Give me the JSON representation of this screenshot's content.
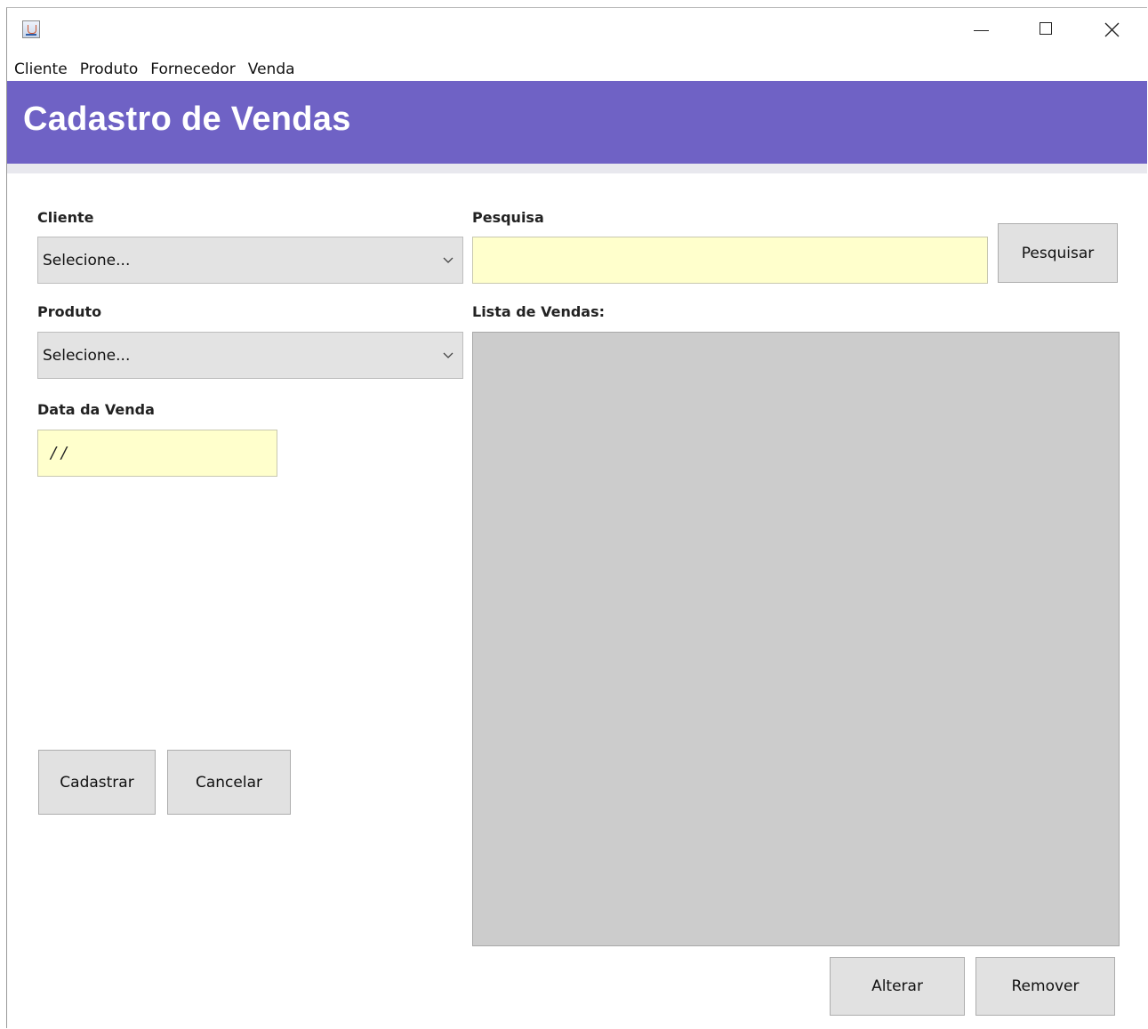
{
  "menu": {
    "items": [
      "Cliente",
      "Produto",
      "Fornecedor",
      "Venda"
    ]
  },
  "header": {
    "title": "Cadastro de Vendas",
    "background_color": "#6f62c5"
  },
  "form": {
    "cliente_label": "Cliente",
    "cliente_value": "Selecione...",
    "produto_label": "Produto",
    "produto_value": "Selecione...",
    "data_label": "Data da Venda",
    "data_value": "/ /",
    "cadastrar_label": "Cadastrar",
    "cancelar_label": "Cancelar"
  },
  "search": {
    "label": "Pesquisa",
    "value": "",
    "button_label": "Pesquisar"
  },
  "list": {
    "label": "Lista de Vendas:",
    "alterar_label": "Alterar",
    "remover_label": "Remover"
  },
  "icons": {
    "app": "java-app-icon",
    "minimize": "minimize-icon",
    "maximize": "maximize-icon",
    "close": "close-icon",
    "dropdown": "chevron-down-icon"
  },
  "colors": {
    "input_background": "#ffffcc",
    "list_background": "#cccccc"
  }
}
